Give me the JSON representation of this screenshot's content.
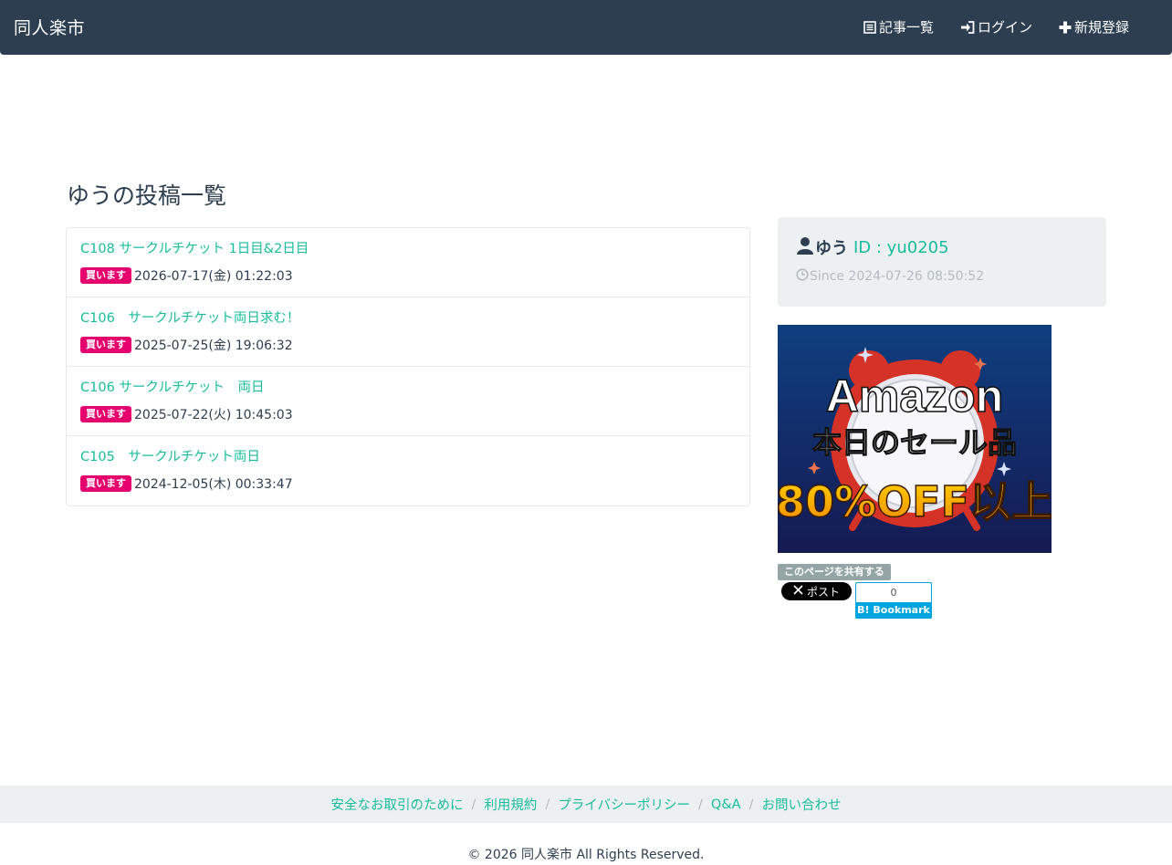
{
  "navbar": {
    "brand": "同人楽市",
    "items": [
      {
        "label": "記事一覧",
        "icon": "list-icon"
      },
      {
        "label": "ログイン",
        "icon": "login-icon"
      },
      {
        "label": "新規登録",
        "icon": "plus-icon"
      }
    ]
  },
  "page_title": "ゆうの投稿一覧",
  "posts": [
    {
      "title": "C108 サークルチケット 1日目&2日目",
      "badge": "買います",
      "date": "2026-07-17(金) 01:22:03"
    },
    {
      "title": "C106　サークルチケット両日求む！",
      "badge": "買います",
      "date": "2025-07-25(金) 19:06:32"
    },
    {
      "title": "C106 サークルチケット　両日",
      "badge": "買います",
      "date": "2025-07-22(火) 10:45:03"
    },
    {
      "title": "C105　サークルチケット両日",
      "badge": "買います",
      "date": "2024-12-05(木) 00:33:47"
    }
  ],
  "profile": {
    "name": "ゆう",
    "id": "ID : yu0205",
    "since": "Since 2024-07-26 08:50:52"
  },
  "ad": {
    "line1": "Amazon",
    "line2": "本日のセール品",
    "line3": "80%OFF以上"
  },
  "share": {
    "label": "このページを共有する",
    "x_post": "ポスト",
    "hatena_count": "0",
    "hatena_label": "Bookmark"
  },
  "footer": {
    "links": [
      "安全なお取引のために",
      "利用規約",
      "プライバシーポリシー",
      "Q&A",
      "お問い合わせ"
    ],
    "separator": "/",
    "copyright": "© 2026 同人楽市 All Rights Reserved."
  },
  "colors": {
    "navbar": "#2c3e50",
    "accent": "#18bc9c",
    "badge": "#e5006e",
    "panel": "#ecf0f1",
    "muted": "#b4bcc2"
  }
}
